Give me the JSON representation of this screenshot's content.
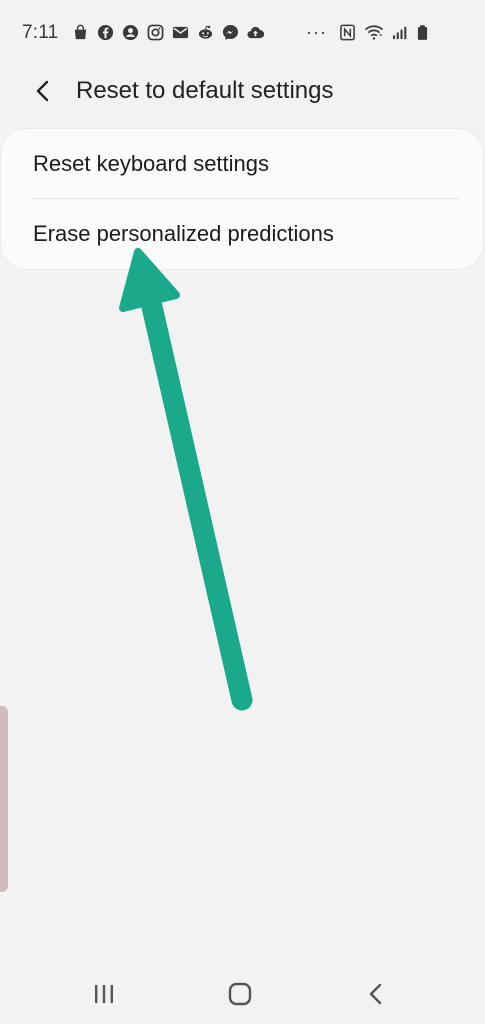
{
  "status_bar": {
    "time": "7:11",
    "more": "···",
    "icons_left": [
      "shopping-bag-icon",
      "facebook-icon",
      "account-circle-icon",
      "instagram-icon",
      "mail-icon",
      "reddit-icon",
      "messenger-icon",
      "cloud-upload-icon"
    ],
    "icons_right": [
      "nfc-icon",
      "wifi-icon",
      "signal-icon",
      "battery-icon"
    ]
  },
  "header": {
    "back_icon": "chevron-left-icon",
    "title": "Reset to default settings"
  },
  "settings": {
    "items": [
      {
        "label": "Reset keyboard settings"
      },
      {
        "label": "Erase personalized predictions"
      }
    ]
  },
  "annotation": {
    "arrow_color": "#1aa98a"
  },
  "nav_bar": {
    "recents_icon": "recent-apps-icon",
    "home_icon": "home-icon",
    "back_icon": "back-icon"
  },
  "colors": {
    "background": "#f2f2f2",
    "card": "#fbfbfb",
    "side_tab": "#cfbcbc"
  }
}
